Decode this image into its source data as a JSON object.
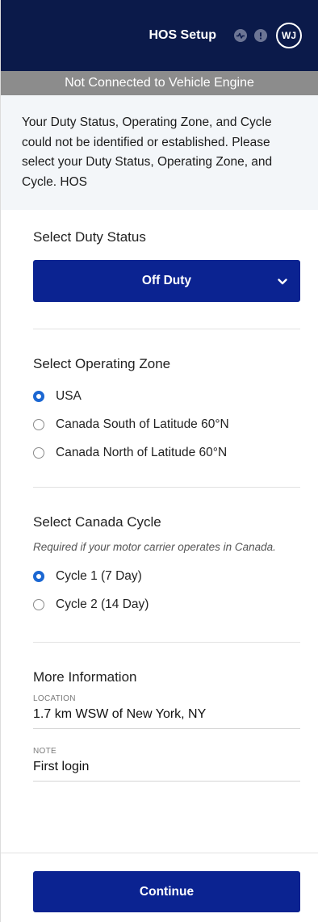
{
  "header": {
    "title": "HOS Setup",
    "avatar_initials": "WJ",
    "icons": [
      "activity-icon",
      "alert-icon"
    ]
  },
  "status_bar": {
    "text": "Not Connected to Vehicle Engine"
  },
  "notice": {
    "text": "Your Duty Status, Operating Zone, and Cycle could not be identified or established. Please select your Duty Status, Operating Zone, and Cycle. HOS"
  },
  "duty_status": {
    "title": "Select Duty Status",
    "selected": "Off Duty"
  },
  "operating_zone": {
    "title": "Select Operating Zone",
    "options": [
      {
        "label": "USA",
        "checked": true
      },
      {
        "label": "Canada South of Latitude 60°N",
        "checked": false
      },
      {
        "label": "Canada North of Latitude 60°N",
        "checked": false
      }
    ]
  },
  "canada_cycle": {
    "title": "Select Canada Cycle",
    "hint": "Required if your motor carrier operates in Canada.",
    "options": [
      {
        "label": "Cycle 1 (7 Day)",
        "checked": true
      },
      {
        "label": "Cycle 2 (14 Day)",
        "checked": false
      }
    ]
  },
  "more_info": {
    "title": "More Information",
    "location_label": "LOCATION",
    "location_value": "1.7 km WSW of New York, NY",
    "note_label": "NOTE",
    "note_value": "First login"
  },
  "footer": {
    "continue_label": "Continue"
  },
  "colors": {
    "header_bg": "#0b1a4a",
    "primary": "#0b2391",
    "radio_checked": "#1b67d2",
    "status_bar_bg": "#8c8c8c",
    "notice_bg": "#f3f6f9"
  }
}
